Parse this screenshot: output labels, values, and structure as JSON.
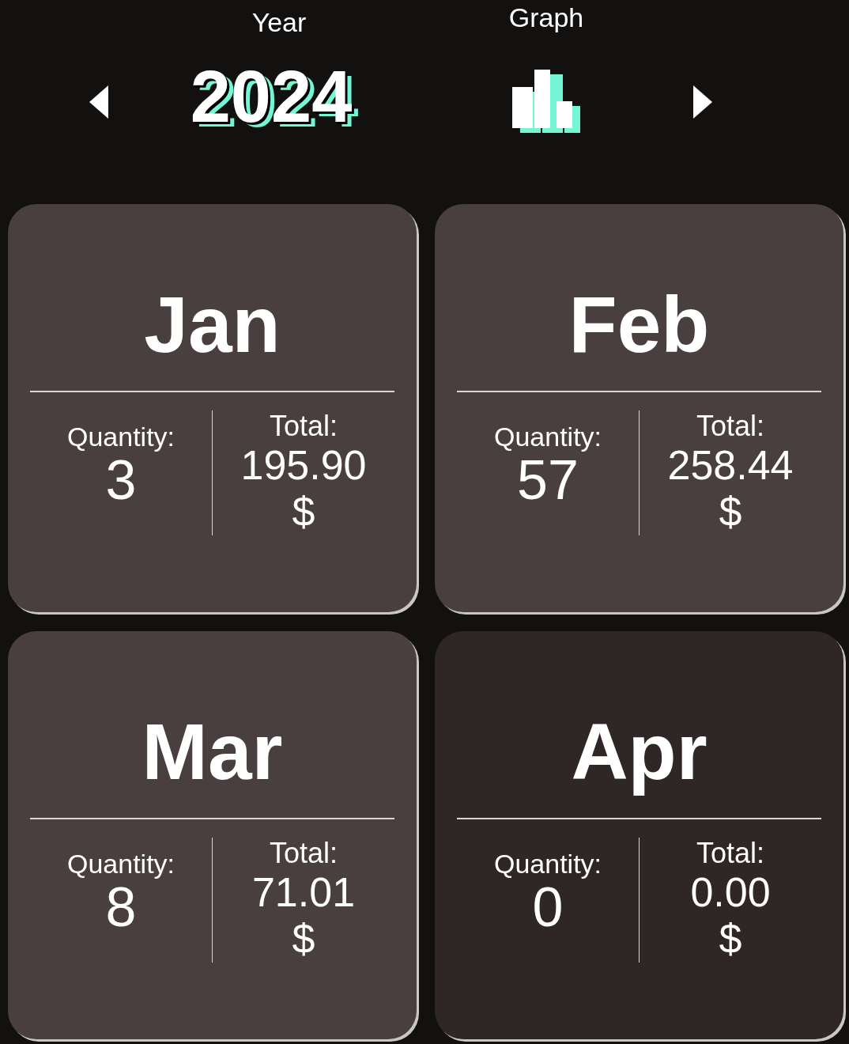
{
  "header": {
    "year_label": "Year",
    "year": "2024",
    "graph_label": "Graph"
  },
  "months": [
    {
      "name": "Jan",
      "quantity_label": "Quantity:",
      "quantity": "3",
      "total_label": "Total:",
      "total": "195.90",
      "currency": "$",
      "selected": false
    },
    {
      "name": "Feb",
      "quantity_label": "Quantity:",
      "quantity": "57",
      "total_label": "Total:",
      "total": "258.44",
      "currency": "$",
      "selected": false
    },
    {
      "name": "Mar",
      "quantity_label": "Quantity:",
      "quantity": "8",
      "total_label": "Total:",
      "total": "71.01",
      "currency": "$",
      "selected": false
    },
    {
      "name": "Apr",
      "quantity_label": "Quantity:",
      "quantity": "0",
      "total_label": "Total:",
      "total": "0.00",
      "currency": "$",
      "selected": true
    }
  ]
}
